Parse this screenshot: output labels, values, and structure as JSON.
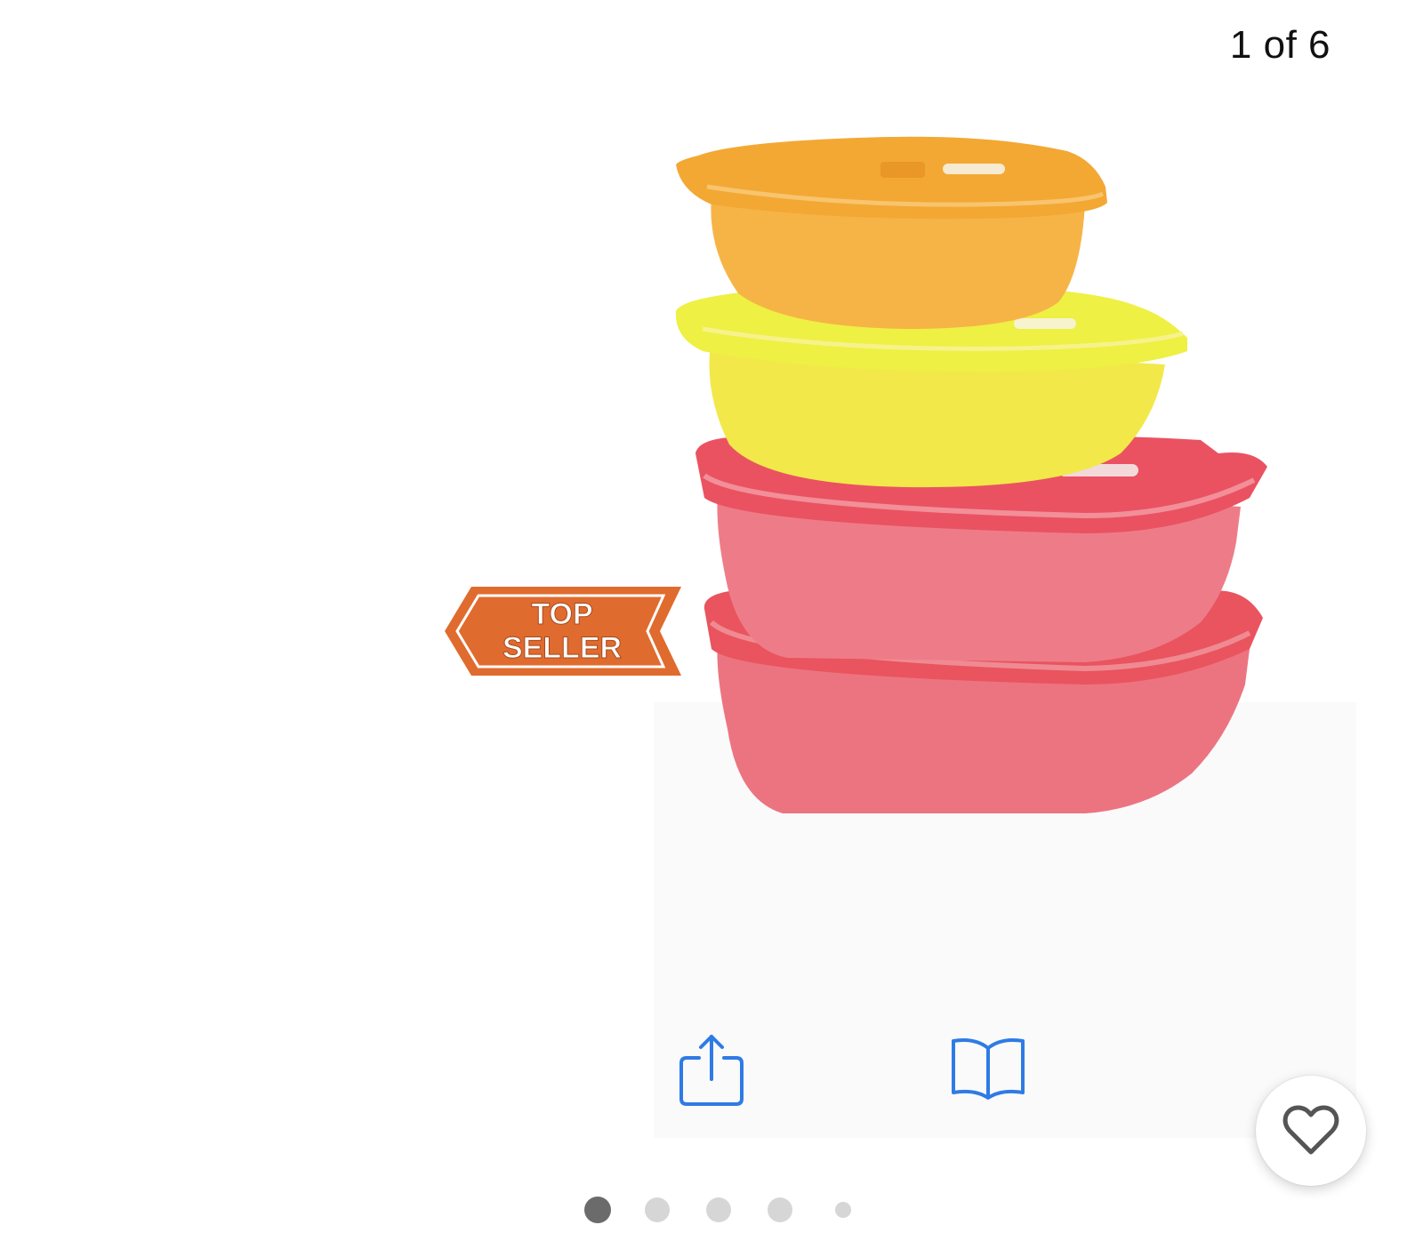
{
  "viewer": {
    "counter": "1 of 6",
    "current_index": 1,
    "total_images": 6
  },
  "product": {
    "badge_line1": "TOP",
    "badge_line2": "SELLER",
    "container_colors": [
      "#f5ad3c",
      "#f3e63c",
      "#ea6b78",
      "#ea6b78"
    ]
  },
  "toolbar": {
    "share_icon": "share-icon",
    "reader_icon": "book-open-icon",
    "favorite_icon": "heart-outline-icon",
    "accent_color": "#2f7be5"
  },
  "pagination": {
    "dots": [
      {
        "state": "active"
      },
      {
        "state": "inactive"
      },
      {
        "state": "inactive"
      },
      {
        "state": "inactive"
      },
      {
        "state": "small"
      }
    ]
  }
}
